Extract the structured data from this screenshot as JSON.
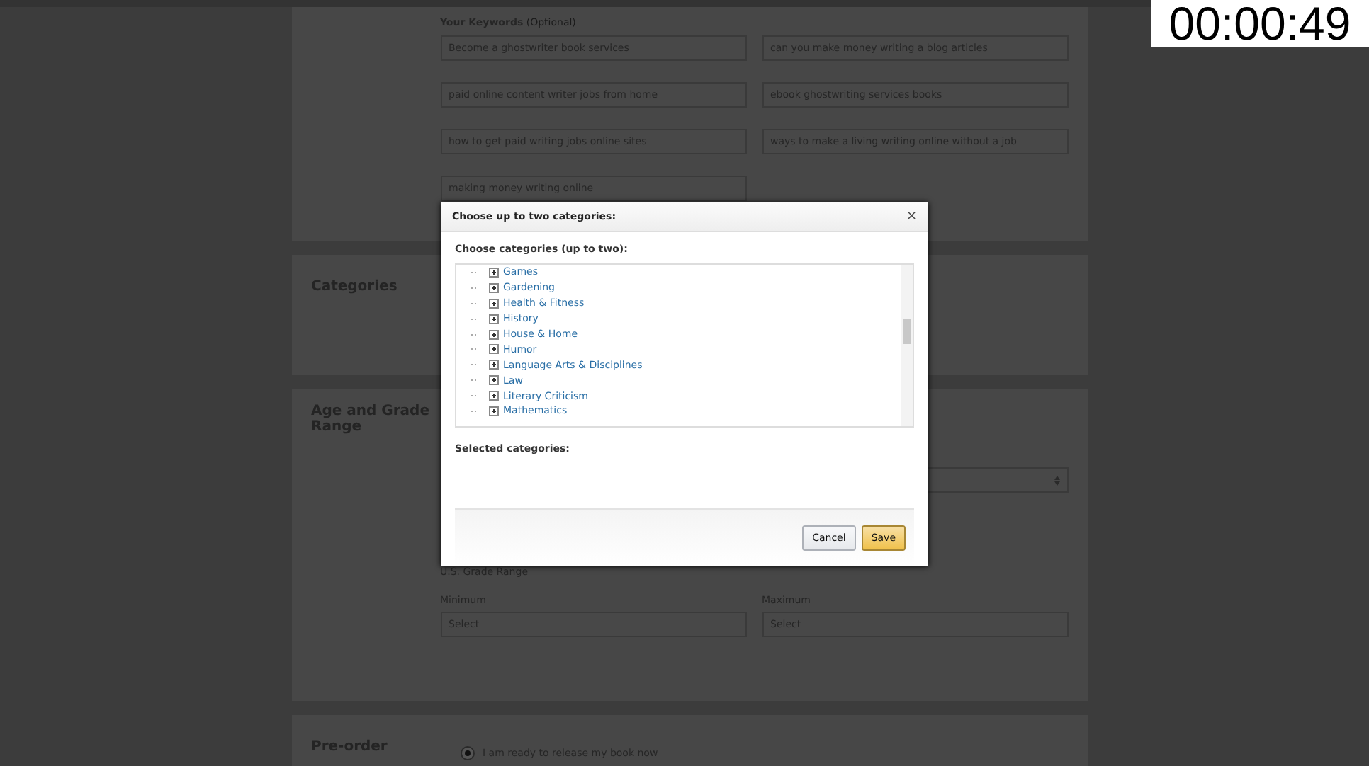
{
  "timer": "00:00:49",
  "keywords": {
    "label": "Your Keywords",
    "hint": "(Optional)",
    "values": [
      "Become a ghostwriter book services",
      "can you make money writing a blog articles",
      "paid online content writer jobs from home",
      "ebook ghostwriting services books",
      "how to get paid writing jobs online sites",
      "ways to make a living writing online without a job",
      "making money writing online"
    ]
  },
  "categories_section": {
    "title": "Categories"
  },
  "age_section": {
    "title": "Age and Grade Range",
    "us_grade_label": "U.S. Grade Range",
    "minimum_label": "Minimum",
    "maximum_label": "Maximum",
    "minimum_value": "Select",
    "maximum_value": "Select"
  },
  "preorder_section": {
    "title": "Pre-order",
    "option": {
      "label": "I am ready to release my book now",
      "selected": true
    }
  },
  "dialog": {
    "title": "Choose up to two categories:",
    "close": "×",
    "tree_label": "Choose categories (up to two):",
    "tree_items": [
      {
        "label": "Games",
        "expanded": false
      },
      {
        "label": "Gardening",
        "expanded": false
      },
      {
        "label": "Health & Fitness",
        "expanded": false
      },
      {
        "label": "History",
        "expanded": false
      },
      {
        "label": "House & Home",
        "expanded": false
      },
      {
        "label": "Humor",
        "expanded": false
      },
      {
        "label": "Language Arts & Disciplines",
        "expanded": false
      },
      {
        "label": "Law",
        "expanded": false
      },
      {
        "label": "Literary Criticism",
        "expanded": false
      },
      {
        "label": "Mathematics",
        "expanded": false
      }
    ],
    "selected_label": "Selected categories:",
    "buttons": [
      {
        "label": "Cancel",
        "kind": "secondary"
      },
      {
        "label": "Save",
        "kind": "primary"
      }
    ]
  }
}
